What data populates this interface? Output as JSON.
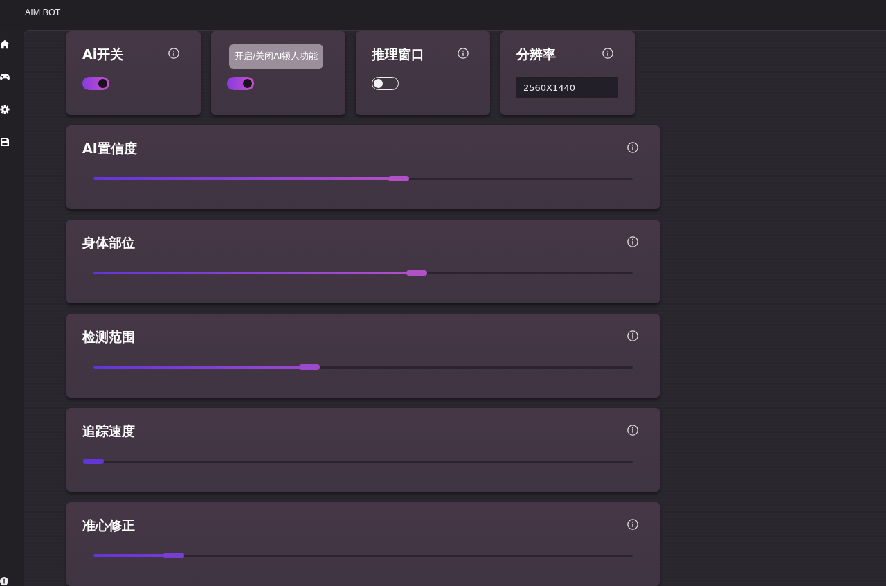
{
  "window": {
    "title": "AIM BOT"
  },
  "top_cards": [
    {
      "kind": "toggle",
      "title": "Ai开关",
      "on": true
    },
    {
      "kind": "toggle",
      "on": true,
      "tooltip": "开启/关闭AI锁人功能"
    },
    {
      "kind": "toggle",
      "title": "推理窗口",
      "on": false
    },
    {
      "kind": "field",
      "title": "分辨率",
      "value": "2560X1440"
    }
  ],
  "sliders": [
    {
      "title": "AI置信度",
      "level": 0.566
    },
    {
      "title": "身体部位",
      "level": 0.6
    },
    {
      "title": "检测范围",
      "level": 0.4
    },
    {
      "title": "追踪速度",
      "level": 0
    },
    {
      "title": "准心修正",
      "level": 0.149
    }
  ]
}
